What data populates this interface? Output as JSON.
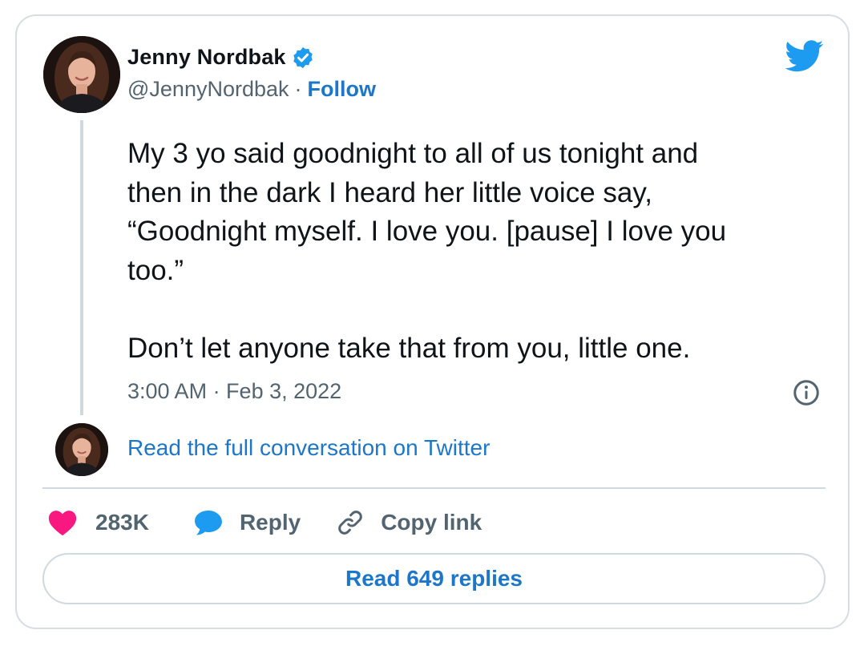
{
  "author": {
    "display_name": "Jenny Nordbak",
    "handle": "@JennyNordbak",
    "separator": "·",
    "follow_label": "Follow",
    "verified": true
  },
  "tweet": {
    "text": "My 3 yo said goodnight to all of us tonight and\nthen in the dark I heard her little voice say,\n“Goodnight myself. I love you. [pause] I love you\ntoo.”\n\nDon’t let anyone take that from you, little one.",
    "timestamp": "3:00 AM · Feb 3, 2022"
  },
  "conversation": {
    "read_full_label": "Read the full conversation on Twitter"
  },
  "actions": {
    "like_count": "283K",
    "reply_label": "Reply",
    "copy_link_label": "Copy link",
    "read_replies_label": "Read 649 replies"
  },
  "icons": {
    "brand": "twitter-bird-icon",
    "verified": "verified-badge-icon",
    "info": "info-icon",
    "like": "heart-icon",
    "reply": "speech-bubble-icon",
    "copy_link": "link-icon"
  },
  "colors": {
    "brand_blue": "#1d9bf0",
    "link_blue": "#1d77c8",
    "like_pink": "#f91880",
    "text_primary": "#0f1419",
    "text_secondary": "#536471",
    "border": "#cfd9de"
  }
}
